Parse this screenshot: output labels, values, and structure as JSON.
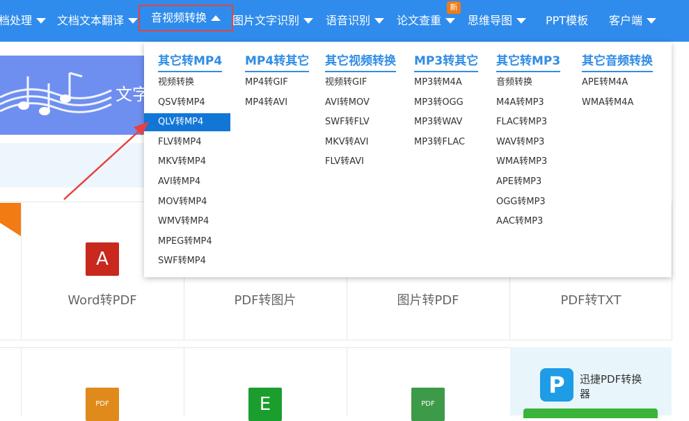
{
  "nav": {
    "items": [
      {
        "label": "档处理",
        "caret": true
      },
      {
        "label": "文档文本翻译",
        "caret": true
      },
      {
        "label": "音视频转换",
        "caret": true,
        "active": true
      },
      {
        "label": "图片文字识别",
        "caret": true
      },
      {
        "label": "语音识别",
        "caret": true
      },
      {
        "label": "论文查重",
        "caret": true
      },
      {
        "label": "思维导图",
        "caret": true
      },
      {
        "label": "PPT模板",
        "caret": false
      },
      {
        "label": "客户端",
        "caret": true
      }
    ],
    "badge": "新"
  },
  "banner": {
    "text": "文字"
  },
  "dropdown": {
    "columns": [
      {
        "title": "其它转MP4",
        "items": [
          "视频转换",
          "QSV转MP4",
          "QLV转MP4",
          "FLV转MP4",
          "MKV转MP4",
          "AVI转MP4",
          "MOV转MP4",
          "WMV转MP4",
          "MPEG转MP4",
          "SWF转MP4"
        ]
      },
      {
        "title": "MP4转其它",
        "items": [
          "MP4转GIF",
          "MP4转AVI"
        ]
      },
      {
        "title": "其它视频转换",
        "items": [
          "视频转GIF",
          "AVI转MOV",
          "SWF转FLV",
          "MKV转AVI",
          "FLV转AVI"
        ]
      },
      {
        "title": "MP3转其它",
        "items": [
          "MP3转M4A",
          "MP3转OGG",
          "MP3转WAV",
          "MP3转FLAC"
        ]
      },
      {
        "title": "其它转MP3",
        "items": [
          "音频转换",
          "M4A转MP3",
          "FLAC转MP3",
          "WAV转MP3",
          "WMA转MP3",
          "APE转MP3",
          "OGG转MP3",
          "AAC转MP3"
        ]
      },
      {
        "title": "其它音频转换",
        "items": [
          "APE转M4A",
          "WMA转M4A"
        ]
      }
    ],
    "selected": "QLV转MP4"
  },
  "cards": {
    "row1": [
      "Word转PDF",
      "PDF转图片",
      "图片转PDF",
      "PDF转TXT"
    ],
    "icons": {
      "pdf": "A",
      "excel": "E",
      "pdf_file": "PDF"
    }
  },
  "promo": {
    "title": "迅捷PDF转换器",
    "logo": "P"
  },
  "colors": {
    "nav": "#2f8cec",
    "accent": "#2f8ce6",
    "selected": "#1276d6",
    "highlight_box": "#e8413e",
    "arrow": "#e8413e"
  }
}
